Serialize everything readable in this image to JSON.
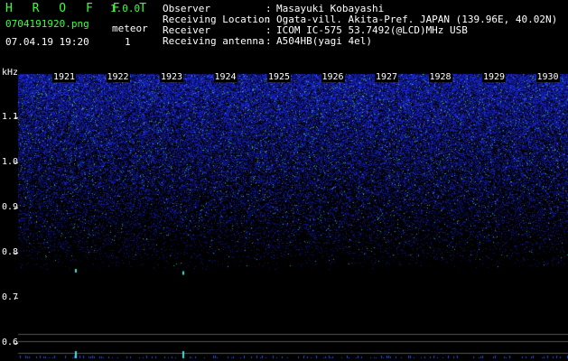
{
  "app": {
    "title": "H R O F F T",
    "version": "1.0.0"
  },
  "file": {
    "name": "0704191920.png",
    "datetime": "07.04.19 19:20"
  },
  "meteor": {
    "label": "meteor",
    "count": "1"
  },
  "info": [
    {
      "key": "Observer",
      "value": "Masayuki Kobayashi"
    },
    {
      "key": "Receiving Location",
      "value": "Ogata-vill. Akita-Pref. JAPAN (139.96E, 40.02N)"
    },
    {
      "key": "Receiver",
      "value": "ICOM IC-575 53.7492(@LCD)MHz USB"
    },
    {
      "key": "Receiving antenna",
      "value": "A504HB(yagi 4el)"
    }
  ],
  "chart_data": {
    "type": "heatmap",
    "ylabel": "kHz",
    "y_ticks": [
      "1.1",
      "1.0",
      "0.9",
      "0.8",
      "0.7",
      "0.6"
    ],
    "x_ticks": [
      "1921",
      "1922",
      "1923",
      "1924",
      "1925",
      "1926",
      "1927",
      "1928",
      "1929",
      "1930"
    ],
    "meteor_echoes": [
      {
        "minute": "1921",
        "frequency_khz": 0.76
      },
      {
        "minute": "1923",
        "frequency_khz": 0.755
      }
    ]
  },
  "colors": {
    "background": "#000000",
    "noise": "#1e28c8",
    "echo": "#40e0e0",
    "header_text": "#ffffff",
    "accent": "#3cff3c"
  }
}
